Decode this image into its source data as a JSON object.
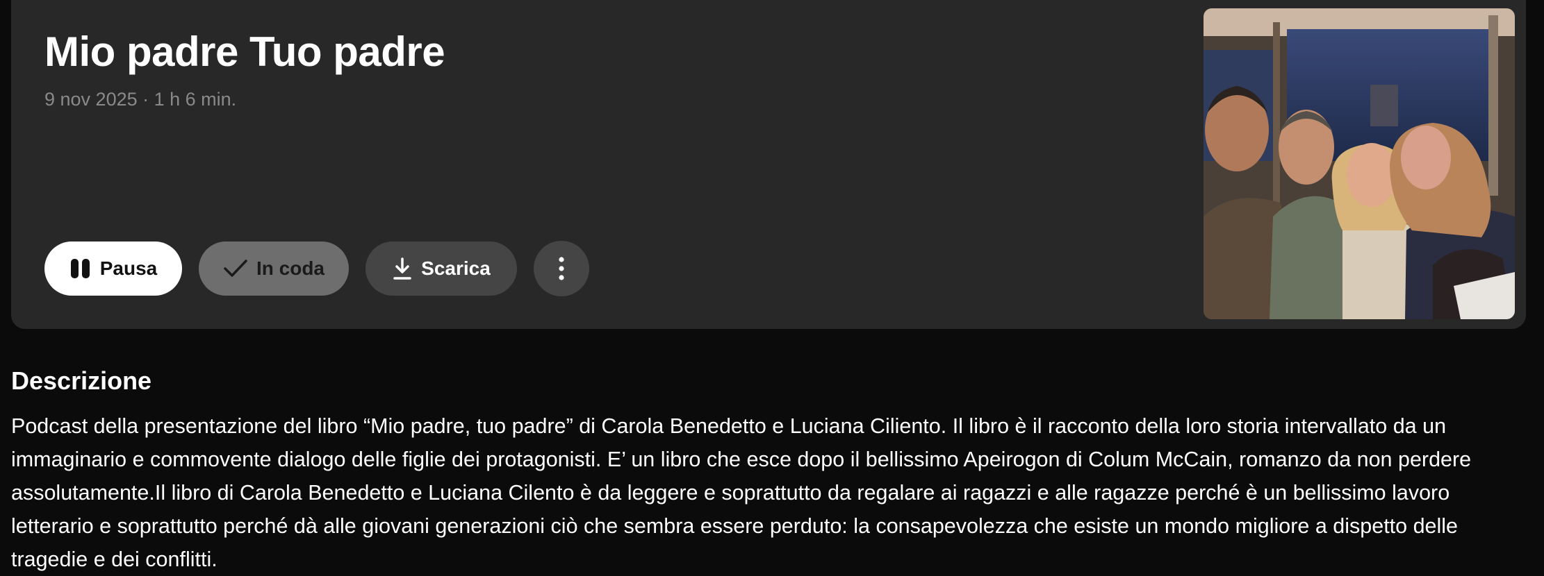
{
  "episode": {
    "title": "Mio padre Tuo padre",
    "meta": "9 nov 2025 · 1 h 6 min."
  },
  "actions": {
    "pause_label": "Pausa",
    "queue_label": "In coda",
    "download_label": "Scarica"
  },
  "icons": {
    "pause": "pause-icon",
    "queue": "check-icon",
    "download": "download-icon",
    "more": "more-vertical-icon"
  },
  "colors": {
    "card_background": "#282828",
    "page_background": "#0b0b0b",
    "primary_button": "#ffffff",
    "queue_button": "#6e6e6e",
    "secondary_button": "#454545",
    "meta_text": "#8a8a8a"
  },
  "description": {
    "heading": "Descrizione",
    "text": "Podcast della presentazione del libro “Mio padre, tuo padre” di Carola Benedetto e Luciana Ciliento. Il libro è il racconto della loro storia intervallato da un immaginario e commovente dialogo delle figlie dei protagonisti. E’ un libro che esce dopo il bellissimo Apeirogon di Colum McCain, romanzo da non perdere assolutamente.Il libro di Carola Benedetto e Luciana Cilento è da leggere e soprattutto da regalare ai ragazzi e alle ragazze perché è un bellissimo lavoro letterario e soprattutto perché dà alle giovani generazioni ciò che sembra essere perduto: la consapevolezza che esiste un mondo migliore a dispetto delle tragedie e dei conflitti."
  }
}
